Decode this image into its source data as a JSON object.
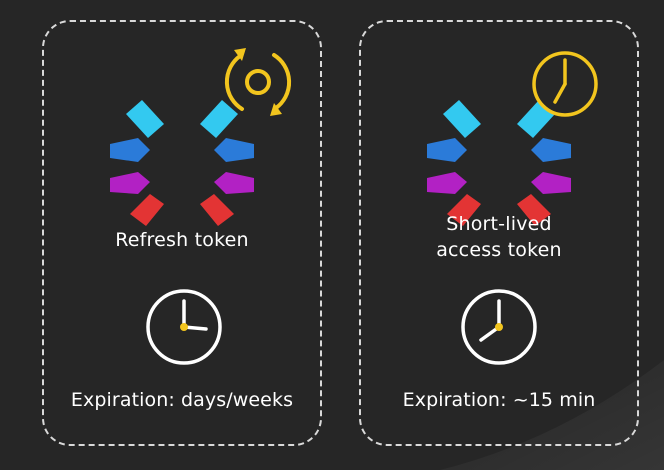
{
  "colors": {
    "background": "#262626",
    "border": "#d9d9d9",
    "accent_yellow": "#f2c51e",
    "blade_cyan": "#33c9f0",
    "blade_blue": "#2b7bd9",
    "blade_purple": "#b221c4",
    "blade_red": "#e33434"
  },
  "refresh_card": {
    "title": "Refresh token",
    "expiration": "Expiration: days/weeks",
    "overlay_icon": "refresh-cycle-icon",
    "clock_icon": "clock-icon"
  },
  "access_card": {
    "title_line1": "Short-lived",
    "title_line2": "access token",
    "expiration": "Expiration: ~15 min",
    "overlay_icon": "clock-icon",
    "clock_icon": "clock-icon"
  }
}
